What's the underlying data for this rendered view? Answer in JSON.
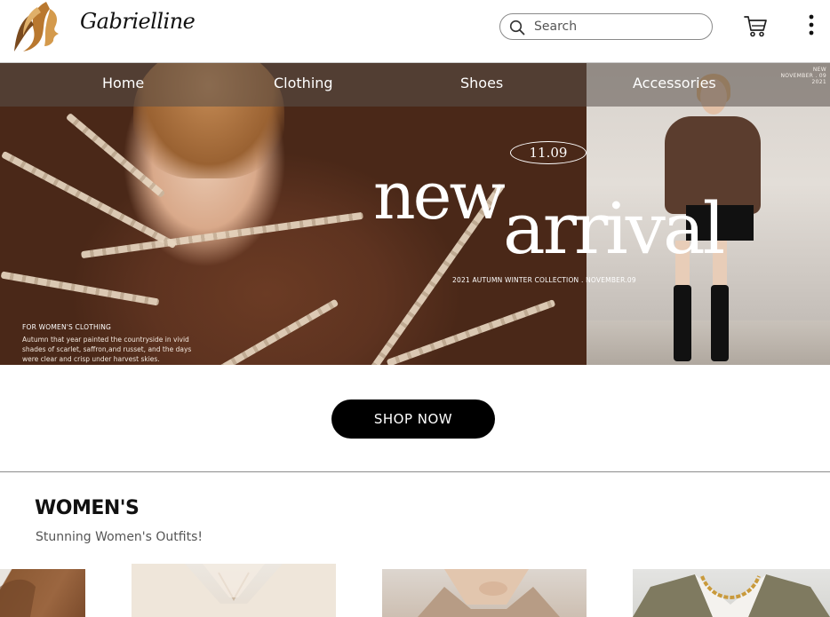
{
  "header": {
    "brand_name": "Gabrielline",
    "logo_icon": "woman-profile-logo-icon",
    "search": {
      "placeholder": "Search",
      "value": "",
      "icon": "search-icon"
    },
    "cart_icon": "cart-icon",
    "more_icon": "more-vertical-icon"
  },
  "nav": {
    "items": [
      {
        "label": "Home"
      },
      {
        "label": "Clothing"
      },
      {
        "label": "Shoes"
      },
      {
        "label": "Accessories"
      }
    ]
  },
  "hero": {
    "date": "11.09",
    "headline_1": "new",
    "headline_2": "arrival",
    "collection_line": "2021 AUTUMN WINTER COLLECTION . NOVEMBER.09",
    "women_title": "FOR WOMEN'S CLOTHING",
    "women_text": "Autumn that year painted the countryside in vivid shades of scarlet, saffron,and russet, and the days were clear and crisp under harvest skies.",
    "corner_line_1": "NEW",
    "corner_line_2": "NOVEMBER . 09",
    "corner_line_3": "2021"
  },
  "cta": {
    "shop_now": "SHOP NOW"
  },
  "women_section": {
    "title": "WOMEN'S",
    "subtitle": "Stunning Women's Outfits!"
  },
  "colors": {
    "nav_overlay": "#5a504b",
    "button_bg": "#000000",
    "logo_gold": "#b9782f"
  }
}
